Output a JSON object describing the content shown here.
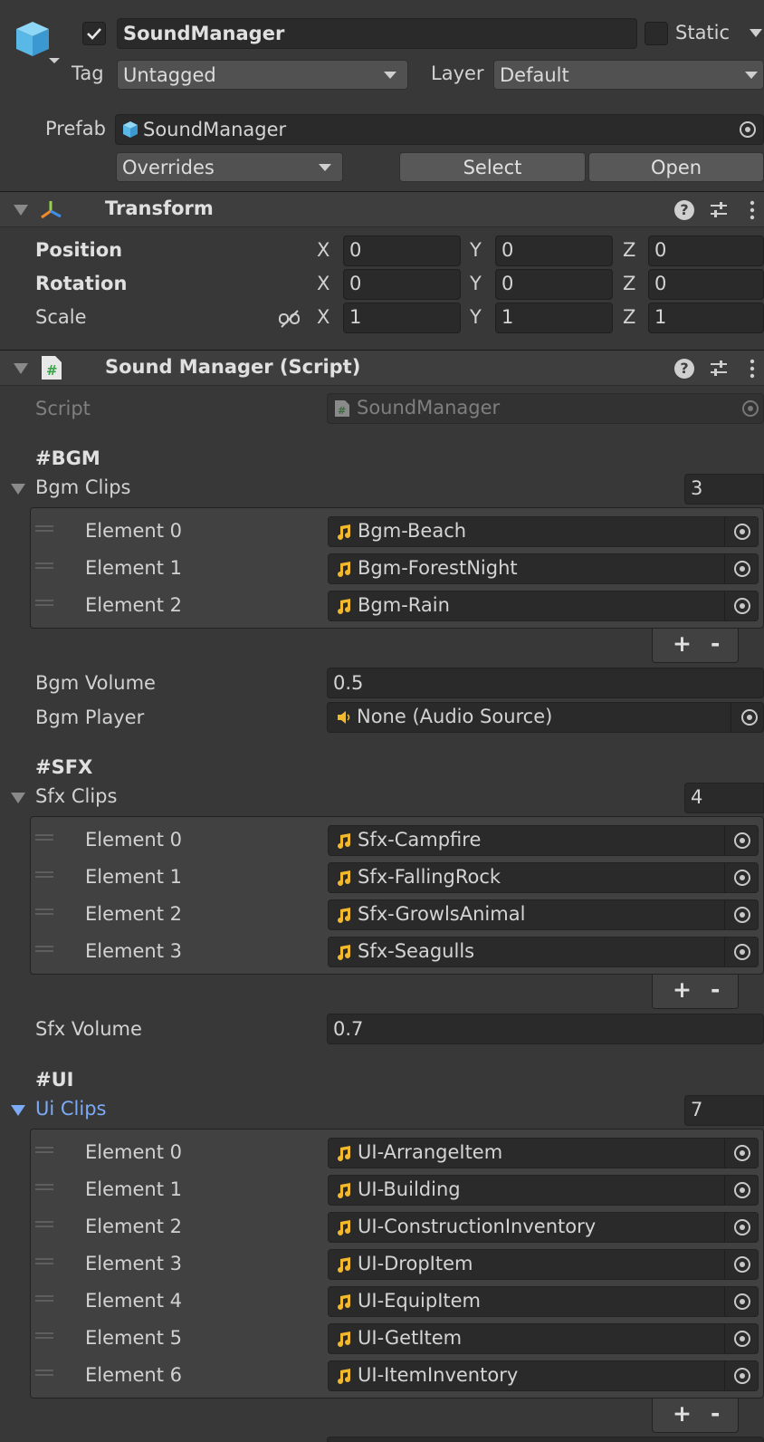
{
  "header": {
    "object_name": "SoundManager",
    "active_checked": true,
    "static_label": "Static",
    "tag_label": "Tag",
    "tag_value": "Untagged",
    "layer_label": "Layer",
    "layer_value": "Default",
    "prefab_label": "Prefab",
    "prefab_value": "SoundManager",
    "overrides_label": "Overrides",
    "select_label": "Select",
    "open_label": "Open"
  },
  "transform": {
    "title": "Transform",
    "rows": [
      {
        "label": "Position",
        "x": "0",
        "y": "0",
        "z": "0"
      },
      {
        "label": "Rotation",
        "x": "0",
        "y": "0",
        "z": "0"
      },
      {
        "label": "Scale",
        "x": "1",
        "y": "1",
        "z": "1"
      }
    ],
    "axis_x": "X",
    "axis_y": "Y",
    "axis_z": "Z"
  },
  "script_component": {
    "title": "Sound Manager (Script)",
    "script_label": "Script",
    "script_value": "SoundManager",
    "bgm": {
      "section": "#BGM",
      "list_label": "Bgm Clips",
      "count": "3",
      "elements": [
        {
          "label": "Element 0",
          "value": "Bgm-Beach"
        },
        {
          "label": "Element 1",
          "value": "Bgm-ForestNight"
        },
        {
          "label": "Element 2",
          "value": "Bgm-Rain"
        }
      ],
      "volume_label": "Bgm Volume",
      "volume_value": "0.5",
      "player_label": "Bgm Player",
      "player_value": "None (Audio Source)"
    },
    "sfx": {
      "section": "#SFX",
      "list_label": "Sfx Clips",
      "count": "4",
      "elements": [
        {
          "label": "Element 0",
          "value": "Sfx-Campfire"
        },
        {
          "label": "Element 1",
          "value": "Sfx-FallingRock"
        },
        {
          "label": "Element 2",
          "value": "Sfx-GrowlsAnimal"
        },
        {
          "label": "Element 3",
          "value": "Sfx-Seagulls"
        }
      ],
      "volume_label": "Sfx Volume",
      "volume_value": "0.7"
    },
    "ui": {
      "section": "#UI",
      "list_label": "Ui Clips",
      "count": "7",
      "elements": [
        {
          "label": "Element 0",
          "value": "UI-ArrangeItem"
        },
        {
          "label": "Element 1",
          "value": "UI-Building"
        },
        {
          "label": "Element 2",
          "value": "UI-ConstructionInventory"
        },
        {
          "label": "Element 3",
          "value": "UI-DropItem"
        },
        {
          "label": "Element 4",
          "value": "UI-EquipItem"
        },
        {
          "label": "Element 5",
          "value": "UI-GetItem"
        },
        {
          "label": "Element 6",
          "value": "UI-ItemInventory"
        }
      ]
    },
    "add_label": "+",
    "remove_label": "-"
  },
  "colors": {
    "background": "#383838",
    "field": "#2a2a2a",
    "accent_blue": "#7baaf7",
    "audio_icon": "#f1b92b"
  }
}
